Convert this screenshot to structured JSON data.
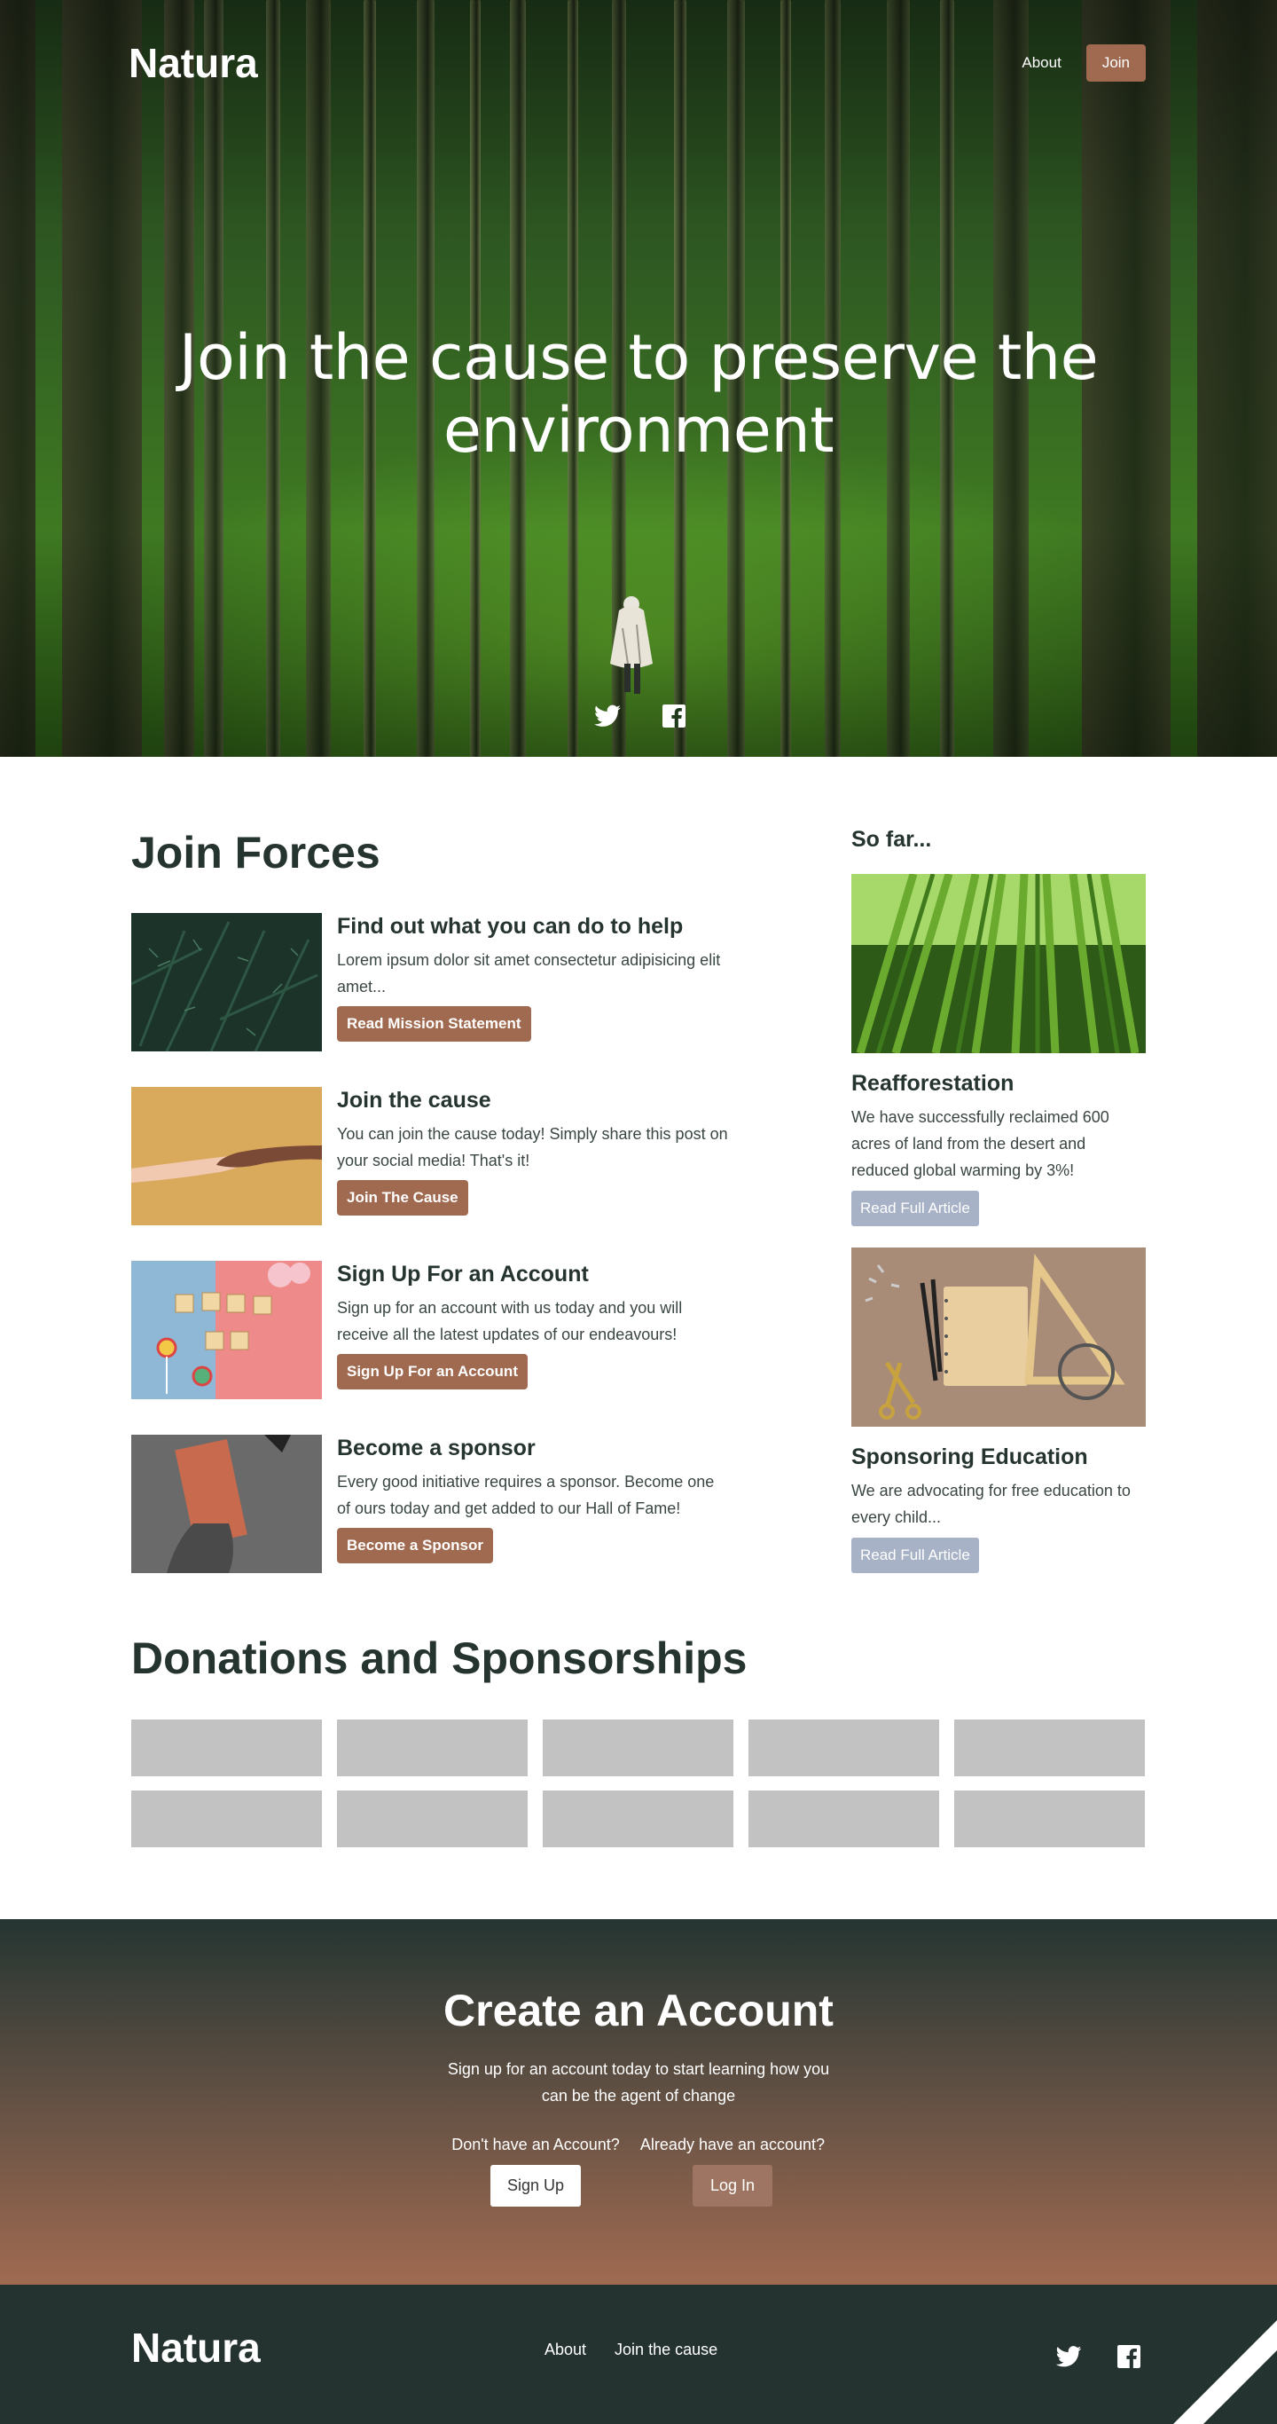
{
  "header": {
    "logo": "Natura",
    "nav_about": "About",
    "nav_join": "Join"
  },
  "hero": {
    "title": "Join the cause to preserve the environment",
    "social": [
      "twitter-icon",
      "facebook-icon"
    ]
  },
  "join_forces": {
    "title": "Join Forces",
    "cards": [
      {
        "title": "Find out what you can do to help",
        "text": "Lorem ipsum dolor sit amet consectetur adipisicing elit amet...",
        "button": "Read Mission Statement"
      },
      {
        "title": "Join the cause",
        "text": "You can join the cause today! Simply share this post on your social media! That's it!",
        "button": "Join The Cause"
      },
      {
        "title": "Sign Up For an Account",
        "text": "Sign up for an account with us today and you will receive all the latest updates of our endeavours!",
        "button": "Sign Up For an Account"
      },
      {
        "title": "Become a sponsor",
        "text": "Every good initiative requires a sponsor. Become one of ours today and get added to our Hall of Fame!",
        "button": "Become a Sponsor"
      }
    ]
  },
  "sidebar": {
    "title": "So far...",
    "articles": [
      {
        "title": "Reafforestation",
        "text": "We have successfully reclaimed 600 acres of land from the desert and reduced global warming by 3%!",
        "button": "Read Full Article"
      },
      {
        "title": "Sponsoring Education",
        "text": "We are advocating for free education to every child...",
        "button": "Read Full Article"
      }
    ]
  },
  "donations": {
    "title": "Donations and Sponsorships",
    "slots": 10
  },
  "create_account": {
    "title": "Create an Account",
    "lead": "Sign up for an account today to start learning how you can be the agent of change",
    "signup_prompt": "Don't have an Account?",
    "signup_button": "Sign Up",
    "login_prompt": "Already have an account?",
    "login_button": "Log In"
  },
  "footer": {
    "logo": "Natura",
    "links": [
      "About",
      "Join the cause"
    ],
    "social": [
      "twitter-icon",
      "facebook-icon"
    ]
  },
  "colors": {
    "brown_accent": "#a06a50",
    "dark_green": "#243230",
    "grey_button": "#a7b2c7",
    "placeholder_grey": "#c2c2c2"
  }
}
